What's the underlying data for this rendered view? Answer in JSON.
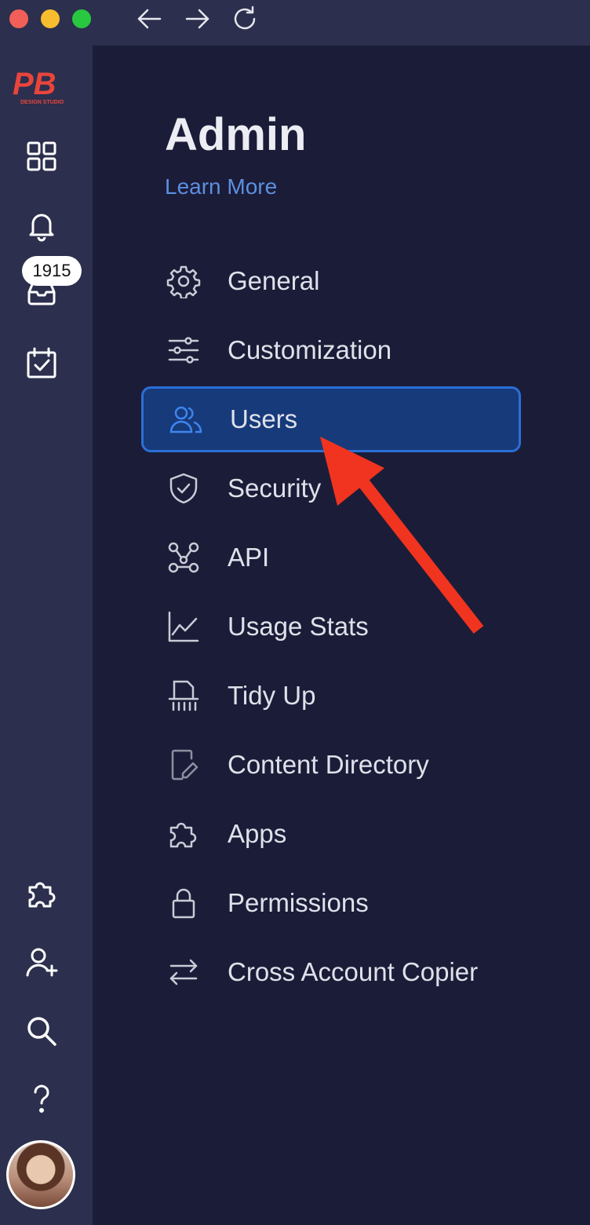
{
  "titlebar": {
    "traffic_lights": [
      "close",
      "minimize",
      "zoom"
    ],
    "nav_icons": [
      "back-arrow-icon",
      "forward-arrow-icon",
      "reload-icon"
    ]
  },
  "rail": {
    "logo_text": "PB",
    "logo_subtext": "DESIGN STUDIO",
    "icons": [
      "grid-icon",
      "bell-icon",
      "inbox-icon",
      "calendar-check-icon",
      "puzzle-icon",
      "add-user-icon",
      "search-icon",
      "help-icon"
    ],
    "inbox_badge": "1915"
  },
  "header": {
    "title": "Admin",
    "learn_more": "Learn More"
  },
  "menu": {
    "items": [
      {
        "label": "General",
        "icon": "gear-icon"
      },
      {
        "label": "Customization",
        "icon": "sliders-icon"
      },
      {
        "label": "Users",
        "icon": "users-icon",
        "active": true
      },
      {
        "label": "Security",
        "icon": "shield-icon"
      },
      {
        "label": "API",
        "icon": "api-nodes-icon"
      },
      {
        "label": "Usage Stats",
        "icon": "line-chart-icon"
      },
      {
        "label": "Tidy Up",
        "icon": "shredder-icon"
      },
      {
        "label": "Content Directory",
        "icon": "document-edit-icon"
      },
      {
        "label": "Apps",
        "icon": "puzzle-icon"
      },
      {
        "label": "Permissions",
        "icon": "lock-icon"
      },
      {
        "label": "Cross Account Copier",
        "icon": "transfer-arrows-icon"
      }
    ]
  },
  "colors": {
    "background": "#1b1c38",
    "rail": "#2c2f4d",
    "active_item": "#173a7a",
    "link": "#5c8fe0",
    "annotation_arrow": "#f0341f"
  }
}
